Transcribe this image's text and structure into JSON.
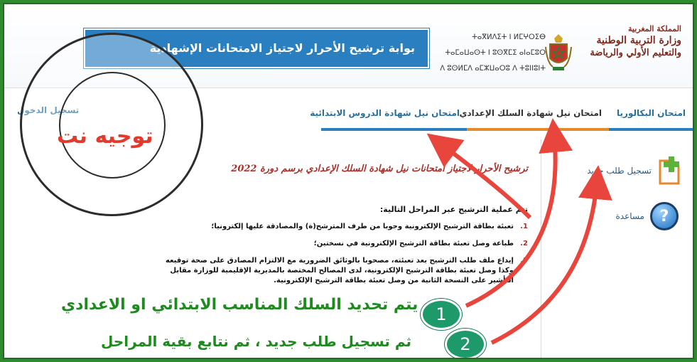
{
  "header": {
    "portal_title": "بوابة ترشيح الأحرار لاجتياز الامتحانات الإشهادية",
    "kingdom": "المملكة المغربية",
    "ministry_line1": "وزارة التربية الوطنية",
    "ministry_line2": "والتعليم الأولي والرياضة",
    "tifinagh_line1": "ⵜⴰⴳⵍⴷⵉⵜ ⵏ ⵍⵎⵖⵔⵉⴱ",
    "tifinagh_line2": "ⵜⴰⵎⴰⵡⴰⵙⵜ ⵏ ⵓⵙⴳⵎⵉ ⴰⵏⴰⵎⵓⵔ",
    "tifinagh_line3": "ⴷ ⵓⵙⵍⵎⴷ ⴰⵎⵣⵡⴰⵔⵓ ⴷ ⵜⵓⵏⵏⵓⵏⵜ"
  },
  "tabs": [
    {
      "label": "امتحان البكالوريا"
    },
    {
      "label": "امتحان نيل شهادة السلك الإعدادي"
    },
    {
      "label": "امتحان نيل شهادة الدروس الابتدائية"
    }
  ],
  "tab_left": "تسجيل الدخول",
  "side": {
    "new_request": "تسجيل طلب جديد",
    "help": "مساعدة"
  },
  "main": {
    "heading": "ترشيح الأحرار لاجتياز امتحانات نيل شهادة السلك الإعدادي برسم دورة 2022",
    "intro": "تتم عملية الترشيح عبر المراحل التالية:",
    "steps": [
      {
        "n": "1.",
        "text": "تعبئة بطاقة الترشيح الإلكترونية وجوبا من طرف المترشح(ة) والمصادقة عليها إلكترونيا؛"
      },
      {
        "n": "2.",
        "text": "طباعة وصل تعبئة بطاقة الترشيح الإلكترونية في نسختين؛"
      },
      {
        "n": "3.",
        "text": "إيداع ملف طلب الترشيح بعد تعبئته، مصحوبا بالوثائق الضرورية مع الالتزام المصادق على صحة توقيعه وكذا وصل تعبئة بطاقة الترشيح الإلكترونية، لدى المصالح المختصة بالمديرية الإقليمية للوزارة مقابل التأشير على النسخة الثانية من وصل تعبئة بطاقة الترشيح الإلكترونية."
      }
    ]
  },
  "callouts": {
    "step1_num": "1",
    "step1_text": "يتم تحديد السلك المناسب الابتدائي او الاعدادي",
    "step2_num": "2",
    "step2_text": "ثم تسجيل طلب جديد ، ثم نتابع بقية المراحل"
  },
  "watermark": {
    "brand": "توجيه نت"
  },
  "colors": {
    "portal_box": "#2a7fc0",
    "active_tab_underline": "#e48a2b",
    "arrow": "#e8453c",
    "callout_text": "#1f8a1f",
    "frame": "#2e8b2e"
  }
}
